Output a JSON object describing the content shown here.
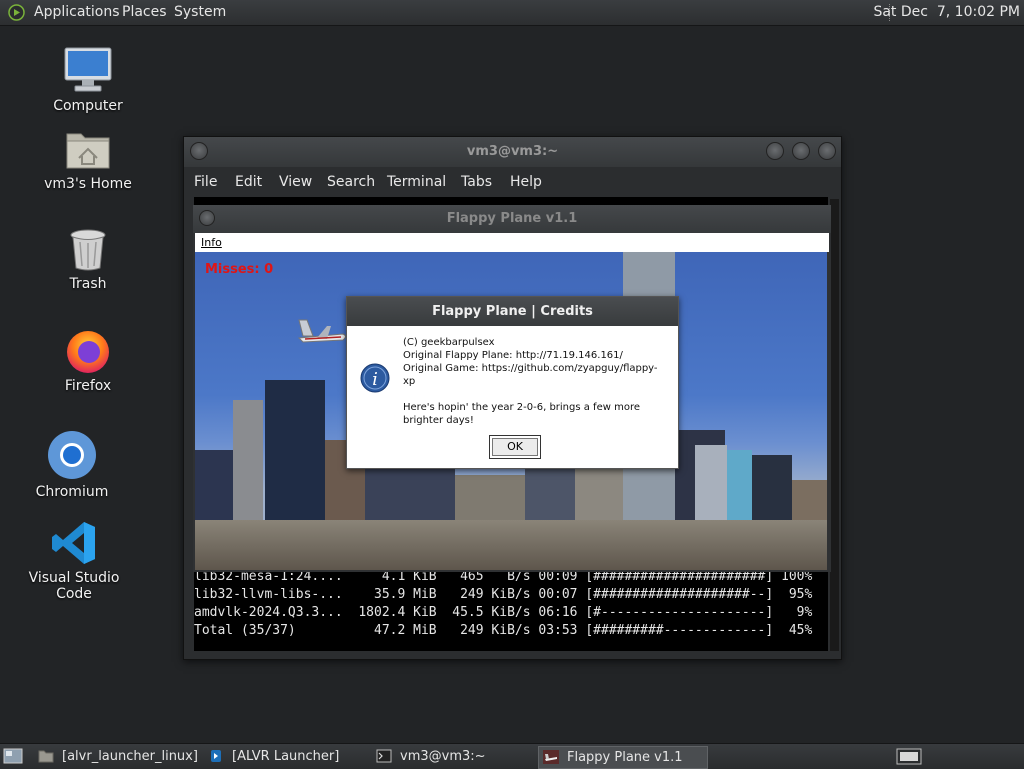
{
  "top_panel": {
    "menus": [
      "Applications",
      "Places",
      "System"
    ],
    "clock": "Sat Dec  7, 10:02 PM"
  },
  "desktop_icons": [
    {
      "label": "Computer",
      "icon": "monitor-icon"
    },
    {
      "label": "vm3's Home",
      "icon": "home-folder-icon"
    },
    {
      "label": "Trash",
      "icon": "trash-icon"
    },
    {
      "label": "Firefox",
      "icon": "firefox-icon"
    },
    {
      "label": "Chromium",
      "icon": "chromium-icon"
    },
    {
      "label": "Visual Studio Code",
      "icon": "vscode-icon"
    }
  ],
  "terminal": {
    "title": "vm3@vm3:~",
    "menu": [
      "File",
      "Edit",
      "View",
      "Search",
      "Terminal",
      "Tabs",
      "Help"
    ],
    "lines": [
      "lib32-mesa-1:24....     4.1 KiB   465   B/s 00:09 [######################] 100%",
      "lib32-llvm-libs-...    35.9 MiB   249 KiB/s 00:07 [####################--]  95%",
      "amdvlk-2024.Q3.3...  1802.4 KiB  45.5 KiB/s 06:16 [#---------------------]   9%",
      "Total (35/37)          47.2 MiB   249 KiB/s 03:53 [#########-------------]  45%"
    ]
  },
  "flappy": {
    "title": "Flappy Plane v1.1",
    "menu_info": "Info",
    "misses": "Misses: 0"
  },
  "dialog": {
    "title": "Flappy Plane | Credits",
    "lines": [
      "(C) geekbarpulsex",
      "Original Flappy Plane: http://71.19.146.161/",
      "Original Game: https://github.com/zyapguy/flappy-",
      "xp",
      "Here's hopin' the year 2-0-6, brings a few more",
      "brighter days!"
    ],
    "ok_label": "OK"
  },
  "taskbar": [
    {
      "label": "[alvr_launcher_linux]",
      "icon": "folder-icon"
    },
    {
      "label": "[ALVR Launcher]",
      "icon": "alvr-icon"
    },
    {
      "label": "vm3@vm3:~",
      "icon": "terminal-icon"
    },
    {
      "label": "Flappy Plane v1.1",
      "icon": "flappy-app-icon",
      "active": true
    }
  ]
}
